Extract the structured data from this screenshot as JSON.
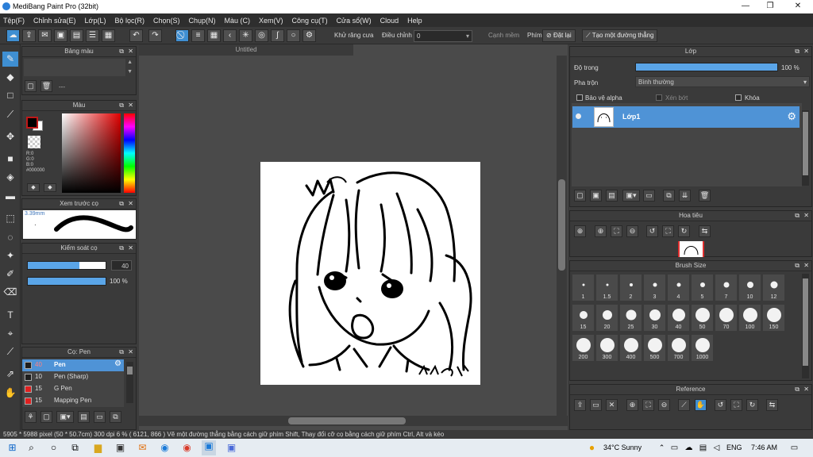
{
  "window": {
    "title": "MediBang Paint Pro (32bit)",
    "min": "—",
    "max": "❐",
    "close": "✕"
  },
  "menu": [
    "Tệp(F)",
    "Chỉnh sửa(E)",
    "Lớp(L)",
    "Bộ lọc(R)",
    "Chọn(S)",
    "Chụp(N)",
    "Màu (C)",
    "Xem(V)",
    "Công cụ(T)",
    "Cửa sổ(W)",
    "Cloud",
    "Help"
  ],
  "toolbar": {
    "antialias_label": "Khử răng cưa",
    "adjust_label": "Điều chỉnh",
    "adjust_value": "0",
    "snap_label": "Cạnh mềm",
    "key_label": "Phím",
    "reset_label": "Đặt lại",
    "straight_line_label": "Tạo một đường thẳng"
  },
  "panels": {
    "color_bar": {
      "title": "Bảng màu",
      "dash": "---"
    },
    "color": {
      "title": "Màu",
      "r": "R:0",
      "g": "G:0",
      "b": "B:0",
      "hex": "#000000",
      "fg": "#000000",
      "bg": "#ffffff"
    },
    "brush_preview": {
      "title": "Xem trước cọ",
      "size": "3.39mm"
    },
    "brush_control": {
      "title": "Kiểm soát cọ",
      "size_value": "40",
      "size_fill": 0.66,
      "opacity_value": "100 %",
      "opacity_fill": 1.0
    },
    "brushes": {
      "title": "Cọ: Pen",
      "items": [
        {
          "size": "40",
          "name": "Pen",
          "color": "#1e1e1e"
        },
        {
          "size": "10",
          "name": "Pen (Sharp)",
          "color": "#1e1e1e"
        },
        {
          "size": "15",
          "name": "G Pen",
          "color": "#e02020"
        },
        {
          "size": "15",
          "name": "Mapping Pen",
          "color": "#e02020"
        }
      ]
    }
  },
  "document": {
    "tab": "Untitled"
  },
  "layer": {
    "title": "Lớp",
    "opacity_label": "Độ trong",
    "opacity_value": "100 %",
    "opacity_fill": 1.0,
    "blend_label": "Pha trộn",
    "blend_value": "Bình thường",
    "protect_alpha": "Bảo vệ alpha",
    "clipping": "Xén bớt",
    "lock": "Khóa",
    "layer_name": "Lớp1"
  },
  "navigator": {
    "title": "Hoa tiêu"
  },
  "brush_size": {
    "title": "Brush Size",
    "sizes": [
      "1",
      "1.5",
      "2",
      "3",
      "4",
      "5",
      "7",
      "10",
      "12",
      "15",
      "20",
      "25",
      "30",
      "40",
      "50",
      "70",
      "100",
      "150",
      "200",
      "300",
      "400",
      "500",
      "700",
      "1000"
    ]
  },
  "reference": {
    "title": "Reference"
  },
  "status": {
    "text": "5905 * 5988 pixel  (50 * 50.7cm)  300 dpi   6 %   ( 6121, 866 )   Vẽ một đường thẳng bằng cách giữ phím Shift, Thay đổi cỡ cọ bằng cách giữ phím Ctrl, Alt và kéo"
  },
  "taskbar": {
    "weather": "34°C  Sunny",
    "lang": "ENG",
    "time": "7:46 AM"
  },
  "icons": {
    "tools": [
      "pen-icon",
      "eraser-icon",
      "rectangle-icon",
      "dot-pen-icon",
      "move-icon",
      "fill-rectangle-icon",
      "bucket-icon",
      "gradient-icon",
      "select-rect-icon",
      "lasso-icon",
      "magic-wand-icon",
      "select-pen-icon",
      "select-eraser-icon",
      "text-icon",
      "divide-icon",
      "eyedropper-icon",
      "swap-icon",
      "hand-icon"
    ]
  }
}
